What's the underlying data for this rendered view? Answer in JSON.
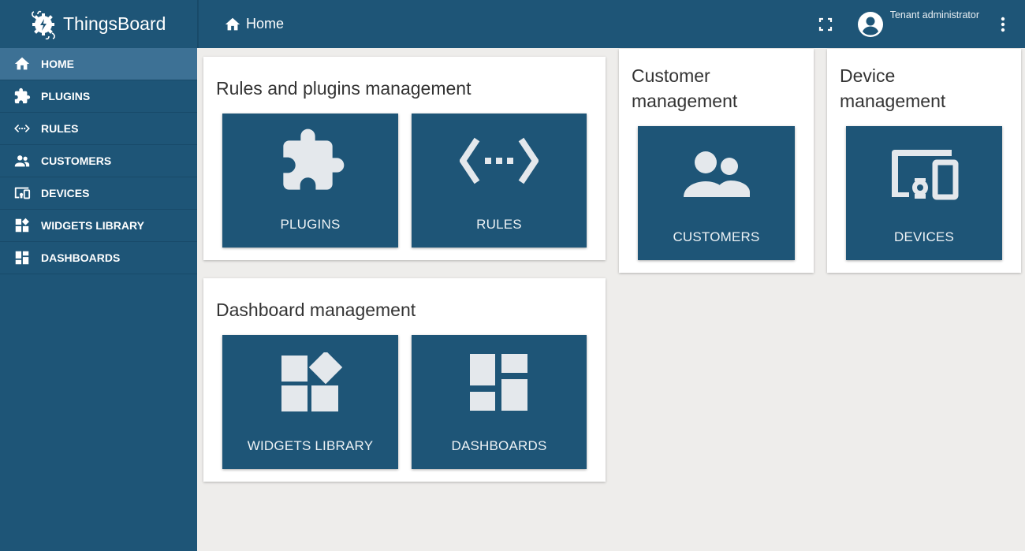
{
  "app": {
    "name": "ThingsBoard"
  },
  "colors": {
    "primary": "#1e5577",
    "active": "#3d7195",
    "background": "#eeedeb",
    "icon": "#e4e8ec"
  },
  "sidebar": {
    "items": [
      {
        "label": "HOME",
        "icon": "home-icon",
        "active": true
      },
      {
        "label": "PLUGINS",
        "icon": "puzzle-icon"
      },
      {
        "label": "RULES",
        "icon": "code-arrows-icon"
      },
      {
        "label": "CUSTOMERS",
        "icon": "people-icon"
      },
      {
        "label": "DEVICES",
        "icon": "devices-icon"
      },
      {
        "label": "WIDGETS LIBRARY",
        "icon": "widgets-icon"
      },
      {
        "label": "DASHBOARDS",
        "icon": "dashboard-icon"
      }
    ]
  },
  "header": {
    "breadcrumb": "Home",
    "user_role": "Tenant administrator"
  },
  "cards": {
    "rules": {
      "title": "Rules and plugins management",
      "tiles": [
        "PLUGINS",
        "RULES"
      ]
    },
    "customers": {
      "title_line1": "Customer",
      "title_line2": "management",
      "tiles": [
        "CUSTOMERS"
      ]
    },
    "devices": {
      "title_line1": "Device",
      "title_line2": "management",
      "tiles": [
        "DEVICES"
      ]
    },
    "dashboards": {
      "title": "Dashboard management",
      "tiles": [
        "WIDGETS LIBRARY",
        "DASHBOARDS"
      ]
    }
  }
}
